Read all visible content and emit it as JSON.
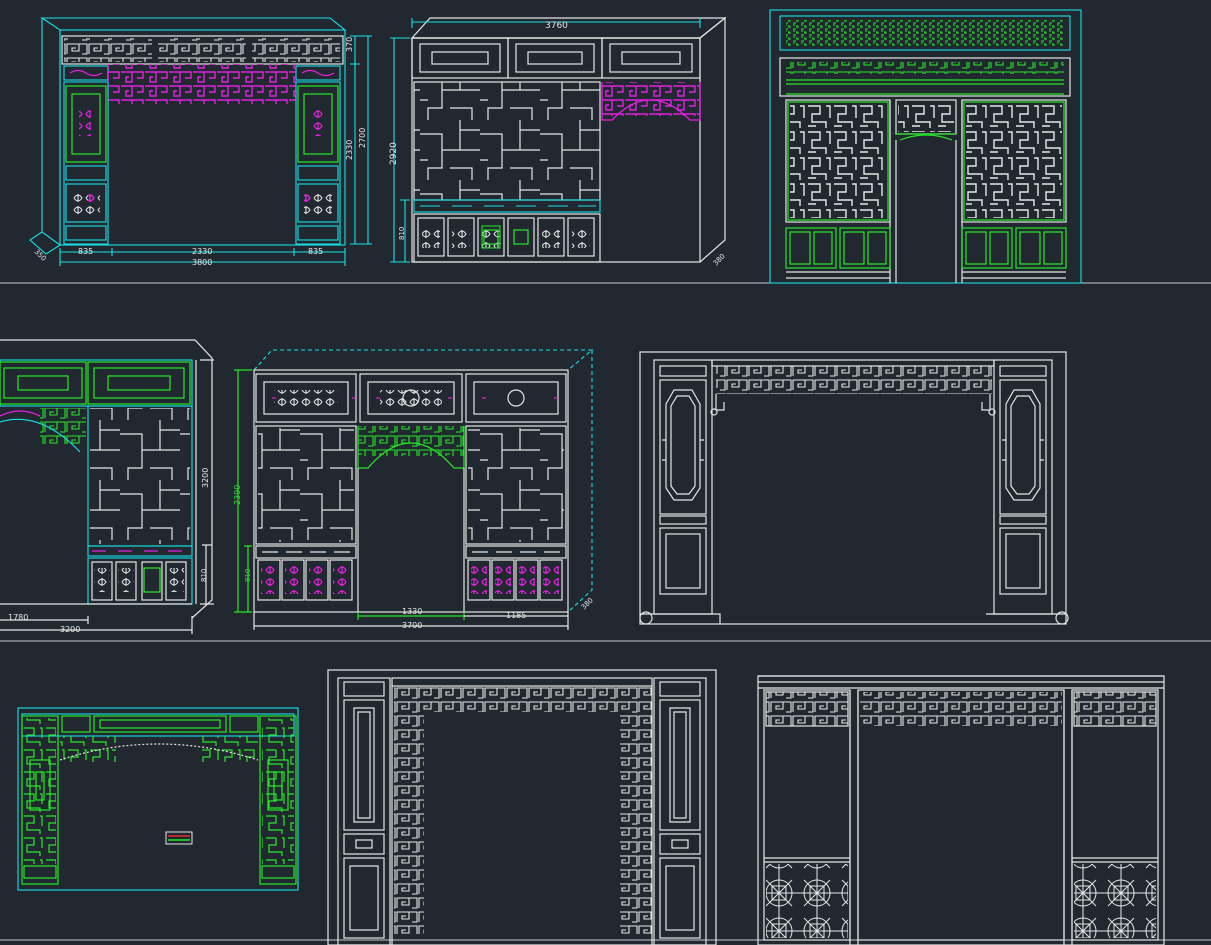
{
  "colors": {
    "background": "#212830",
    "white": "#e6e6e6",
    "cyan": "#19e0e6",
    "green": "#27e827",
    "magenta": "#e31fe0",
    "red": "#e02a2a"
  },
  "drawing1": {
    "dims": [
      "370",
      "2330",
      "2700",
      "835",
      "2330",
      "835",
      "3800",
      "350"
    ]
  },
  "drawing2": {
    "dims": [
      "3760",
      "2920",
      "810",
      "380"
    ]
  },
  "drawing4": {
    "dims": [
      "3200",
      "810",
      "1780",
      "3200"
    ]
  },
  "drawing5": {
    "dims": [
      "2390",
      "810",
      "1330",
      "1185",
      "3700",
      "380"
    ]
  }
}
